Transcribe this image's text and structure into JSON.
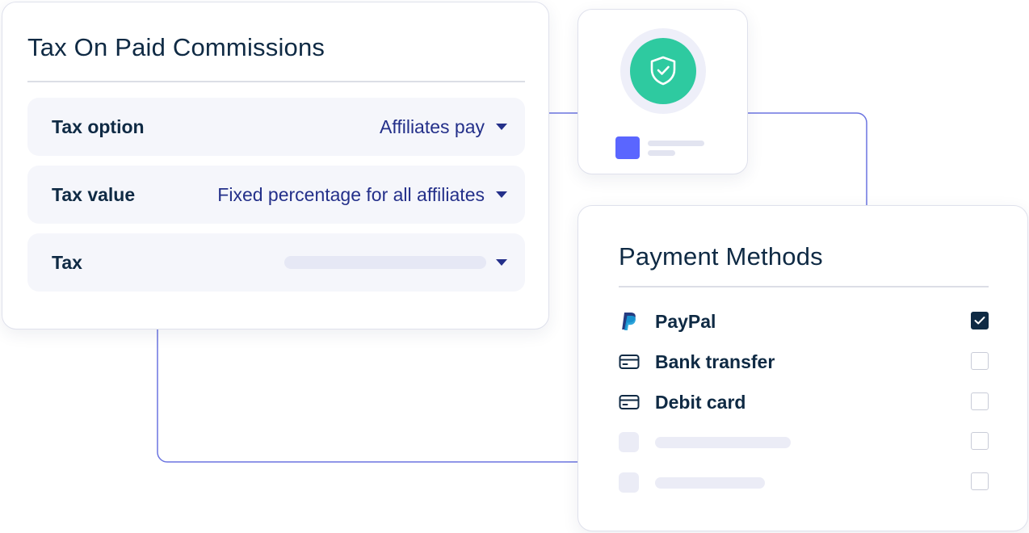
{
  "tax_card": {
    "title": "Tax On Paid Commissions",
    "rows": [
      {
        "label": "Tax option",
        "value": "Affiliates pay"
      },
      {
        "label": "Tax value",
        "value": "Fixed percentage for all affiliates"
      },
      {
        "label": "Tax",
        "value": ""
      }
    ]
  },
  "shield_card": {
    "icon": "shield-check-icon",
    "accent_color": "#2ecaa0",
    "swatch_color": "#5a66ff"
  },
  "payment_card": {
    "title": "Payment Methods",
    "methods": [
      {
        "label": "PayPal",
        "icon": "paypal-icon",
        "checked": true
      },
      {
        "label": "Bank transfer",
        "icon": "credit-card-icon",
        "checked": false
      },
      {
        "label": "Debit card",
        "icon": "credit-card-icon",
        "checked": false
      },
      {
        "label": "",
        "icon": "placeholder-icon",
        "checked": false
      },
      {
        "label": "",
        "icon": "placeholder-icon",
        "checked": false
      }
    ]
  },
  "colors": {
    "text_primary": "#0f2a44",
    "value_blue": "#24308a",
    "connector": "#6b74e0",
    "row_background": "#f5f6fb"
  }
}
